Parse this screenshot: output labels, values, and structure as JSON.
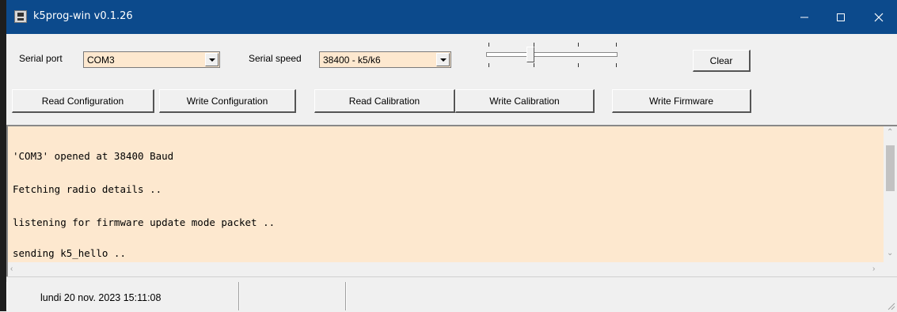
{
  "window": {
    "title": "k5prog-win v0.1.26",
    "controls": {
      "minimize": "minimize-icon",
      "maximize": "maximize-icon",
      "close": "close-icon"
    }
  },
  "toolbar": {
    "serial_port_label": "Serial port",
    "serial_port_value": "COM3",
    "serial_speed_label": "Serial speed",
    "serial_speed_value": "38400 - k5/k6",
    "slider_level": 0.33,
    "clear_label": "Clear",
    "buttons": {
      "read_config": "Read Configuration",
      "write_config": "Write Configuration",
      "read_calibration": "Read Calibration",
      "write_calibration": "Write Calibration",
      "write_firmware": "Write Firmware"
    }
  },
  "log": {
    "lines": [
      "'COM3' opened at 38400 Baud",
      "Fetching radio details ..",
      "listening for firmware update mode packet ..",
      "sending k5_hello .."
    ]
  },
  "statusbar": {
    "datetime": "lundi 20 nov. 2023  15:11:08"
  },
  "colors": {
    "titlebar": "#0c4a8c",
    "field_background": "#fde8cf",
    "window_background": "#f0f0f0"
  }
}
